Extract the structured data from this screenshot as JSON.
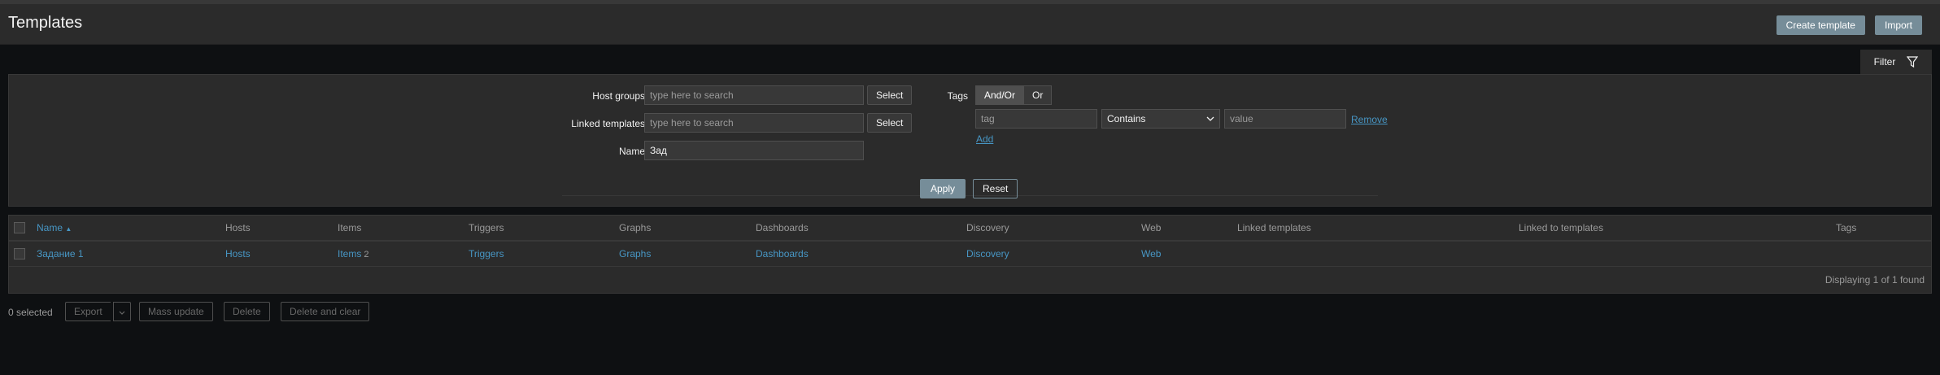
{
  "page": {
    "title": "Templates"
  },
  "header": {
    "create_label": "Create template",
    "import_label": "Import"
  },
  "filter": {
    "tab_label": "Filter",
    "host_groups_label": "Host groups",
    "host_groups_placeholder": "type here to search",
    "linked_templates_label": "Linked templates",
    "linked_templates_placeholder": "type here to search",
    "name_label": "Name",
    "name_value": "Зад",
    "select_label": "Select",
    "tags_label": "Tags",
    "tags_andor": "And/Or",
    "tags_or": "Or",
    "tag_placeholder": "tag",
    "operator_value": "Contains",
    "value_placeholder": "value",
    "remove_label": "Remove",
    "add_label": "Add",
    "apply_label": "Apply",
    "reset_label": "Reset"
  },
  "table": {
    "headers": [
      "Name",
      "Hosts",
      "Items",
      "Triggers",
      "Graphs",
      "Dashboards",
      "Discovery",
      "Web",
      "Linked templates",
      "Linked to templates",
      "Tags"
    ],
    "sort_indicator": "▲",
    "rows": [
      {
        "name": "Задание 1",
        "hosts": "Hosts",
        "items": "Items",
        "items_count": "2",
        "triggers": "Triggers",
        "graphs": "Graphs",
        "dashboards": "Dashboards",
        "discovery": "Discovery",
        "web": "Web"
      }
    ],
    "footer": "Displaying 1 of 1 found"
  },
  "actions": {
    "selected": "0 selected",
    "export": "Export",
    "mass_update": "Mass update",
    "delete": "Delete",
    "delete_clear": "Delete and clear"
  }
}
